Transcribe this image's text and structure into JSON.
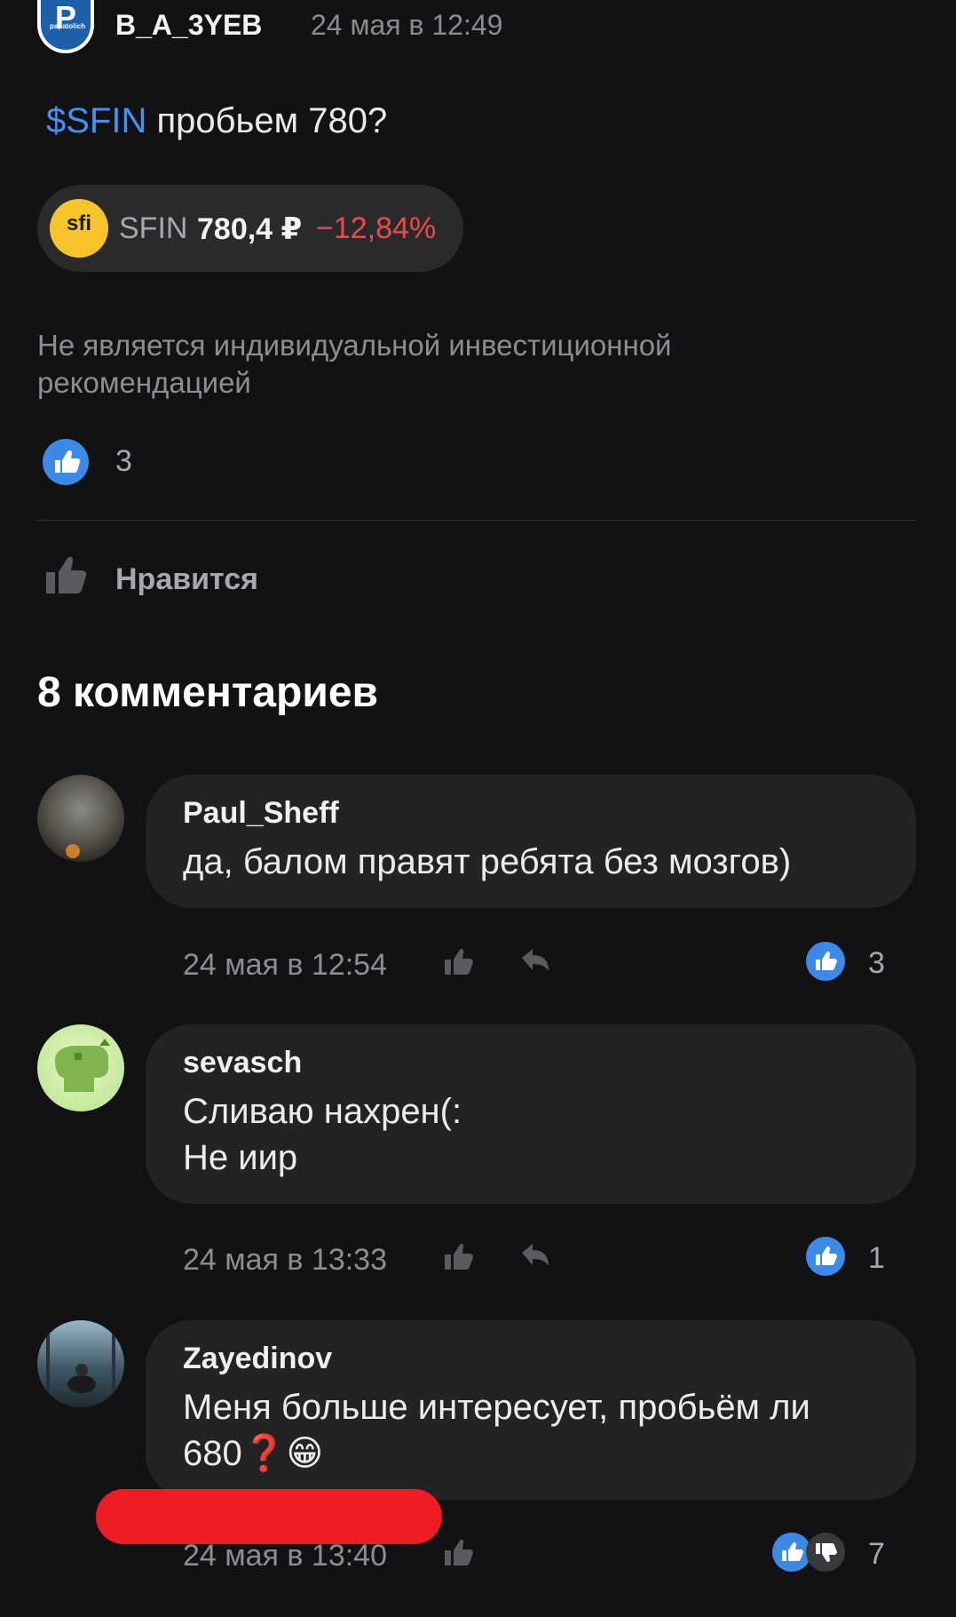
{
  "post": {
    "author": "B_A_3YEB",
    "date": "24 мая в 12:49",
    "avatar_letter": "P",
    "avatar_caption": "papatolich",
    "ticker_link": "$SFIN",
    "text_rest": " пробьем 780?",
    "ticker_pill": {
      "logo_text": "sfi",
      "ticker": "SFIN",
      "price": "780,4 ₽",
      "change": "−12,84%"
    },
    "disclaimer": "Не является индивидуальной инвестиционной рекомендацией",
    "likes_count": "3",
    "like_action": "Нравится"
  },
  "comments_heading": "8 комментариев",
  "comments": [
    {
      "author": "Paul_Sheff",
      "text": "да,  балом правят ребята без мозгов)",
      "date": "24 мая в 12:54",
      "likes": "3"
    },
    {
      "author": "sevasch",
      "text": "Сливаю нахрен(:\nНе иир",
      "date": "24 мая в 13:33",
      "likes": "1"
    },
    {
      "author": "Zayedinov",
      "text": "Меня больше интересует, пробьём ли\n680❓😁",
      "date": "24 мая в 13:40",
      "likes": "7"
    }
  ],
  "colors": {
    "background": "#121214",
    "bubble": "#232326",
    "link": "#4a8ff0",
    "negative": "#e84b4b",
    "like_blue": "#3c8ae6",
    "redaction": "#ee1c24"
  },
  "icons": [
    "thumbs-up-icon",
    "reply-icon",
    "thumbs-down-icon"
  ]
}
